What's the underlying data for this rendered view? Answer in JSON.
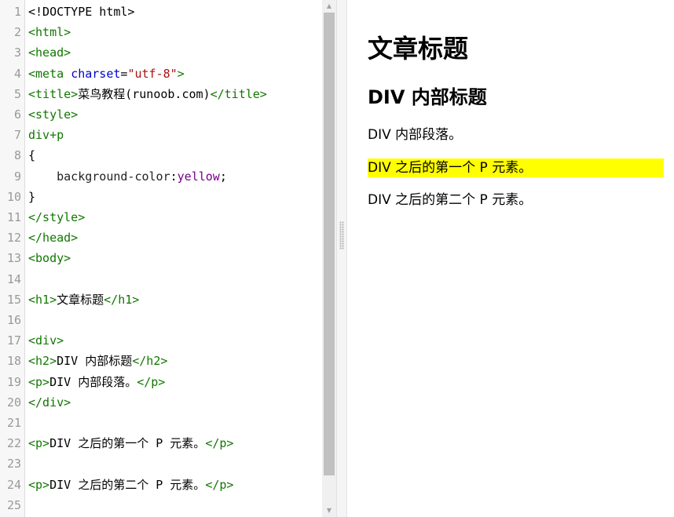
{
  "editor": {
    "lines": [
      {
        "n": "1",
        "parts": [
          [
            "txt",
            "<!DOCTYPE html>"
          ]
        ]
      },
      {
        "n": "2",
        "parts": [
          [
            "tag",
            "<html>"
          ]
        ]
      },
      {
        "n": "3",
        "parts": [
          [
            "tag",
            "<head>"
          ]
        ]
      },
      {
        "n": "4",
        "parts": [
          [
            "tag",
            "<meta "
          ],
          [
            "attr",
            "charset"
          ],
          [
            "txt",
            "="
          ],
          [
            "str",
            "\"utf-8\""
          ],
          [
            "tag",
            ">"
          ]
        ]
      },
      {
        "n": "5",
        "parts": [
          [
            "tag",
            "<title>"
          ],
          [
            "txt",
            "菜鸟教程(runoob.com)"
          ],
          [
            "tag",
            "</title>"
          ]
        ]
      },
      {
        "n": "6",
        "parts": [
          [
            "tag",
            "<style>"
          ]
        ]
      },
      {
        "n": "7",
        "parts": [
          [
            "tag",
            "div+p"
          ]
        ]
      },
      {
        "n": "8",
        "parts": [
          [
            "txt",
            "{"
          ]
        ]
      },
      {
        "n": "9",
        "parts": [
          [
            "prop",
            "    background-color"
          ],
          [
            "txt",
            ":"
          ],
          [
            "val",
            "yellow"
          ],
          [
            "txt",
            ";"
          ]
        ]
      },
      {
        "n": "10",
        "parts": [
          [
            "txt",
            "}"
          ]
        ]
      },
      {
        "n": "11",
        "parts": [
          [
            "tag",
            "</style>"
          ]
        ]
      },
      {
        "n": "12",
        "parts": [
          [
            "tag",
            "</head>"
          ]
        ]
      },
      {
        "n": "13",
        "parts": [
          [
            "tag",
            "<body>"
          ]
        ]
      },
      {
        "n": "14",
        "parts": []
      },
      {
        "n": "15",
        "parts": [
          [
            "tag",
            "<h1>"
          ],
          [
            "txt",
            "文章标题"
          ],
          [
            "tag",
            "</h1>"
          ]
        ]
      },
      {
        "n": "16",
        "parts": []
      },
      {
        "n": "17",
        "parts": [
          [
            "tag",
            "<div>"
          ]
        ]
      },
      {
        "n": "18",
        "parts": [
          [
            "tag",
            "<h2>"
          ],
          [
            "txt",
            "DIV 内部标题"
          ],
          [
            "tag",
            "</h2>"
          ]
        ]
      },
      {
        "n": "19",
        "parts": [
          [
            "tag",
            "<p>"
          ],
          [
            "txt",
            "DIV 内部段落。"
          ],
          [
            "tag",
            "</p>"
          ]
        ]
      },
      {
        "n": "20",
        "parts": [
          [
            "tag",
            "</div>"
          ]
        ]
      },
      {
        "n": "21",
        "parts": []
      },
      {
        "n": "22",
        "parts": [
          [
            "tag",
            "<p>"
          ],
          [
            "txt",
            "DIV 之后的第一个 P 元素。"
          ],
          [
            "tag",
            "</p>"
          ]
        ]
      },
      {
        "n": "23",
        "parts": []
      },
      {
        "n": "24",
        "parts": [
          [
            "tag",
            "<p>"
          ],
          [
            "txt",
            "DIV 之后的第二个 P 元素。"
          ],
          [
            "tag",
            "</p>"
          ]
        ]
      },
      {
        "n": "25",
        "parts": []
      }
    ]
  },
  "preview": {
    "h1": "文章标题",
    "h2": "DIV 内部标题",
    "p1": "DIV 内部段落。",
    "p2": "DIV 之后的第一个 P 元素。",
    "p3": "DIV 之后的第二个 P 元素。",
    "highlight_color": "#ffff00"
  },
  "icons": {
    "scroll_up": "scroll-up-arrow-icon",
    "scroll_down": "scroll-down-arrow-icon",
    "resize_grip": "resize-grip-icon"
  }
}
